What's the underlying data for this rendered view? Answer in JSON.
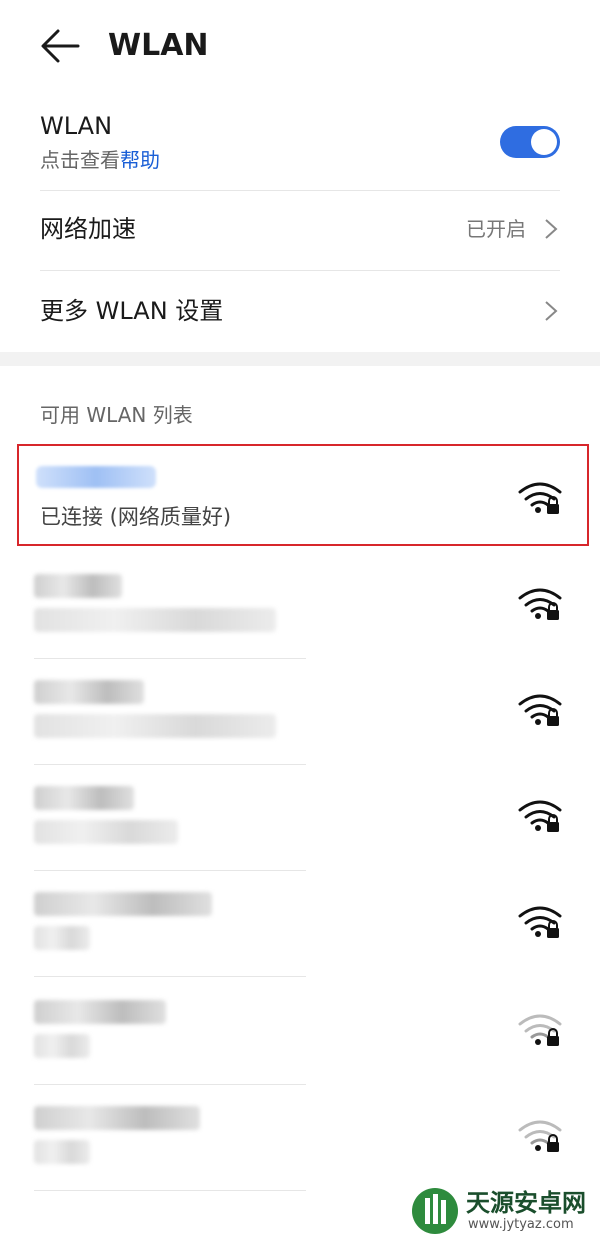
{
  "header": {
    "title": "WLAN",
    "back_icon": "back-arrow-icon"
  },
  "wlan_toggle": {
    "label": "WLAN",
    "sub_prefix": "点击查看",
    "sub_link": "帮助",
    "on": true,
    "accent": "#2f6de1"
  },
  "menu": [
    {
      "label": "网络加速",
      "value": "已开启"
    },
    {
      "label": "更多 WLAN 设置",
      "value": ""
    }
  ],
  "section_title": "可用 WLAN 列表",
  "connected": {
    "status": "已连接 (网络质量好)",
    "signal": "strong",
    "locked": true
  },
  "networks": [
    {
      "signal": "strong",
      "locked": true
    },
    {
      "signal": "strong",
      "locked": true
    },
    {
      "signal": "strong",
      "locked": true
    },
    {
      "signal": "strong",
      "locked": true
    },
    {
      "signal": "weak",
      "locked": true
    },
    {
      "signal": "weak",
      "locked": true
    }
  ],
  "watermark": {
    "title": "天源安卓网",
    "url": "www.jytyaz.com"
  },
  "colors": {
    "highlight_border": "#d7262b",
    "link": "#1a5fd6"
  }
}
